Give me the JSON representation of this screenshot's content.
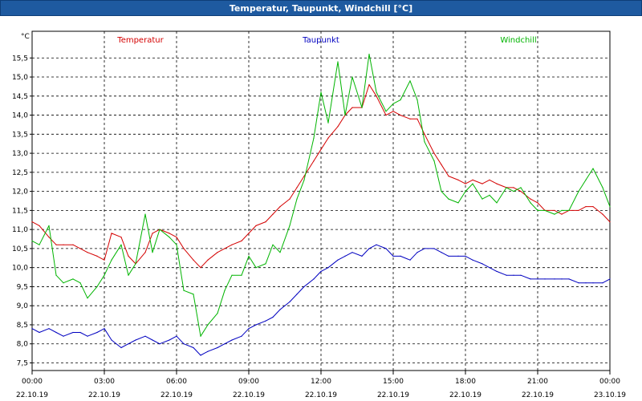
{
  "window": {
    "title": "Temperatur, Taupunkt, Windchill [°C]"
  },
  "colors": {
    "temperature": "#d40000",
    "dewpoint": "#0000c0",
    "windchill": "#00b400",
    "titlebar": "#1e5aa0",
    "grid": "#000000"
  },
  "chart_data": {
    "type": "line",
    "title": "Temperatur, Taupunkt, Windchill [°C]",
    "ylabel": "°C",
    "xlabel": "",
    "ylim": [
      7.3,
      16.2
    ],
    "xlim": [
      0,
      24
    ],
    "grid": true,
    "legend_placement": "top",
    "y_ticks": [
      7.5,
      8.0,
      8.5,
      9.0,
      9.5,
      10.0,
      10.5,
      11.0,
      11.5,
      12.0,
      12.5,
      13.0,
      13.5,
      14.0,
      14.5,
      15.0,
      15.5
    ],
    "y_tick_labels": [
      "7,5",
      "8,0",
      "8,5",
      "9,0",
      "9,5",
      "10,0",
      "10,5",
      "11,0",
      "11,5",
      "12,0",
      "12,5",
      "13,0",
      "13,5",
      "14,0",
      "14,5",
      "15,0",
      "15,5"
    ],
    "x_ticks": [
      0,
      3,
      6,
      9,
      12,
      15,
      18,
      21,
      24
    ],
    "x_tick_times": [
      "00:00",
      "03:00",
      "06:00",
      "09:00",
      "12:00",
      "15:00",
      "18:00",
      "21:00",
      "00:00"
    ],
    "x_tick_dates": [
      "22.10.19",
      "22.10.19",
      "22.10.19",
      "22.10.19",
      "22.10.19",
      "22.10.19",
      "22.10.19",
      "22.10.19",
      "23.10.19"
    ],
    "series": [
      {
        "name": "Temperatur",
        "color": "#d40000",
        "x": [
          0,
          0.3,
          0.7,
          1.0,
          1.3,
          1.7,
          2.0,
          2.3,
          2.7,
          3.0,
          3.3,
          3.7,
          4.0,
          4.3,
          4.7,
          5.0,
          5.3,
          5.7,
          6.0,
          6.3,
          6.7,
          7.0,
          7.3,
          7.7,
          8.0,
          8.3,
          8.7,
          9.0,
          9.3,
          9.7,
          10.0,
          10.3,
          10.7,
          11.0,
          11.3,
          11.7,
          12.0,
          12.3,
          12.7,
          13.0,
          13.3,
          13.7,
          14.0,
          14.3,
          14.7,
          15.0,
          15.3,
          15.7,
          16.0,
          16.3,
          16.7,
          17.0,
          17.3,
          17.7,
          18.0,
          18.3,
          18.7,
          19.0,
          19.3,
          19.7,
          20.0,
          20.3,
          20.7,
          21.0,
          21.3,
          21.7,
          22.0,
          22.3,
          22.7,
          23.0,
          23.3,
          23.7,
          24.0
        ],
        "values": [
          11.2,
          11.1,
          10.8,
          10.6,
          10.6,
          10.6,
          10.5,
          10.4,
          10.3,
          10.2,
          10.9,
          10.8,
          10.3,
          10.1,
          10.4,
          10.9,
          11.0,
          10.9,
          10.8,
          10.5,
          10.2,
          10.0,
          10.2,
          10.4,
          10.5,
          10.6,
          10.7,
          10.9,
          11.1,
          11.2,
          11.4,
          11.6,
          11.8,
          12.1,
          12.4,
          12.8,
          13.1,
          13.4,
          13.7,
          14.0,
          14.2,
          14.2,
          14.8,
          14.5,
          14.0,
          14.1,
          14.0,
          13.9,
          13.9,
          13.5,
          13.0,
          12.7,
          12.4,
          12.3,
          12.2,
          12.3,
          12.2,
          12.3,
          12.2,
          12.1,
          12.1,
          12.0,
          11.8,
          11.7,
          11.5,
          11.5,
          11.4,
          11.5,
          11.5,
          11.6,
          11.6,
          11.4,
          11.2
        ]
      },
      {
        "name": "Taupunkt",
        "color": "#0000c0",
        "x": [
          0,
          0.3,
          0.7,
          1.0,
          1.3,
          1.7,
          2.0,
          2.3,
          2.7,
          3.0,
          3.3,
          3.7,
          4.0,
          4.3,
          4.7,
          5.0,
          5.3,
          5.7,
          6.0,
          6.3,
          6.7,
          7.0,
          7.3,
          7.7,
          8.0,
          8.3,
          8.7,
          9.0,
          9.3,
          9.7,
          10.0,
          10.3,
          10.7,
          11.0,
          11.3,
          11.7,
          12.0,
          12.3,
          12.7,
          13.0,
          13.3,
          13.7,
          14.0,
          14.3,
          14.7,
          15.0,
          15.3,
          15.7,
          16.0,
          16.3,
          16.7,
          17.0,
          17.3,
          17.7,
          18.0,
          18.3,
          18.7,
          19.0,
          19.3,
          19.7,
          20.0,
          20.3,
          20.7,
          21.0,
          21.3,
          21.7,
          22.0,
          22.3,
          22.7,
          23.0,
          23.3,
          23.7,
          24.0
        ],
        "values": [
          8.4,
          8.3,
          8.4,
          8.3,
          8.2,
          8.3,
          8.3,
          8.2,
          8.3,
          8.4,
          8.1,
          7.9,
          8.0,
          8.1,
          8.2,
          8.1,
          8.0,
          8.1,
          8.2,
          8.0,
          7.9,
          7.7,
          7.8,
          7.9,
          8.0,
          8.1,
          8.2,
          8.4,
          8.5,
          8.6,
          8.7,
          8.9,
          9.1,
          9.3,
          9.5,
          9.7,
          9.9,
          10.0,
          10.2,
          10.3,
          10.4,
          10.3,
          10.5,
          10.6,
          10.5,
          10.3,
          10.3,
          10.2,
          10.4,
          10.5,
          10.5,
          10.4,
          10.3,
          10.3,
          10.3,
          10.2,
          10.1,
          10.0,
          9.9,
          9.8,
          9.8,
          9.8,
          9.7,
          9.7,
          9.7,
          9.7,
          9.7,
          9.7,
          9.6,
          9.6,
          9.6,
          9.6,
          9.7
        ]
      },
      {
        "name": "Windchill",
        "color": "#00b400",
        "x": [
          0,
          0.3,
          0.7,
          1.0,
          1.3,
          1.7,
          2.0,
          2.3,
          2.7,
          3.0,
          3.3,
          3.7,
          4.0,
          4.3,
          4.7,
          5.0,
          5.3,
          5.7,
          6.0,
          6.3,
          6.7,
          7.0,
          7.3,
          7.7,
          8.0,
          8.3,
          8.7,
          9.0,
          9.3,
          9.7,
          10.0,
          10.3,
          10.7,
          11.0,
          11.3,
          11.7,
          12.0,
          12.3,
          12.7,
          13.0,
          13.3,
          13.7,
          14.0,
          14.3,
          14.7,
          15.0,
          15.3,
          15.7,
          16.0,
          16.3,
          16.7,
          17.0,
          17.3,
          17.7,
          18.0,
          18.3,
          18.7,
          19.0,
          19.3,
          19.7,
          20.0,
          20.3,
          20.7,
          21.0,
          21.3,
          21.7,
          22.0,
          22.3,
          22.7,
          23.0,
          23.3,
          23.7,
          24.0
        ],
        "values": [
          10.7,
          10.6,
          11.1,
          9.8,
          9.6,
          9.7,
          9.6,
          9.2,
          9.5,
          9.8,
          10.2,
          10.6,
          9.8,
          10.1,
          11.4,
          10.4,
          11.0,
          10.8,
          10.6,
          9.4,
          9.3,
          8.2,
          8.5,
          8.8,
          9.4,
          9.8,
          9.8,
          10.3,
          10.0,
          10.1,
          10.6,
          10.4,
          11.1,
          11.8,
          12.3,
          13.4,
          14.6,
          13.8,
          15.4,
          14.0,
          15.0,
          14.2,
          15.6,
          14.6,
          14.1,
          14.3,
          14.4,
          14.9,
          14.4,
          13.3,
          12.8,
          12.0,
          11.8,
          11.7,
          12.0,
          12.2,
          11.8,
          11.9,
          11.7,
          12.1,
          12.0,
          12.1,
          11.7,
          11.5,
          11.5,
          11.4,
          11.5,
          11.5,
          12.0,
          12.3,
          12.6,
          12.1,
          11.6
        ]
      }
    ]
  }
}
